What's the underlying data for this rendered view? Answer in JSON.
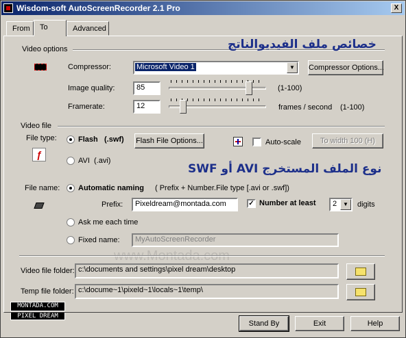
{
  "window": {
    "title": "Wisdom-soft AutoScreenRecorder 2.1 Pro",
    "close_label": "X"
  },
  "tabs": [
    {
      "label": "From"
    },
    {
      "label": "To"
    },
    {
      "label": "Advanced"
    }
  ],
  "video_options": {
    "section_label": "Video options",
    "arabic_caption": "خصائص ملف الفيديوالناتج",
    "compressor_label": "Compressor:",
    "compressor_value": "Microsoft Video 1",
    "compressor_options_button": "Compressor Options...",
    "image_quality_label": "Image quality:",
    "image_quality_value": "85",
    "image_quality_range": "(1-100)",
    "image_quality_level": 0.85,
    "framerate_label": "Framerate:",
    "framerate_value": "12",
    "framerate_unit": "frames / second",
    "framerate_range": "(1-100)",
    "framerate_level": 0.12
  },
  "video_file": {
    "section_label": "Video file",
    "file_type_label": "File type:",
    "flash_label": "Flash",
    "flash_ext": "(.swf)",
    "flash_options_button": "Flash File Options...",
    "auto_scale_label": "Auto-scale",
    "to_width_button": "To width 100 (H)",
    "avi_label": "AVI",
    "avi_ext": "(.avi)",
    "arabic_caption": "نوع الملف المستخرج AVI أو SWF"
  },
  "file_name": {
    "label": "File name:",
    "automatic_label": "Automatic naming",
    "automatic_hint": "( Prefix + Number.File type [.avi or .swf])",
    "prefix_label": "Prefix:",
    "prefix_value": "Pixeldream@montada.com",
    "number_label": "Number at least",
    "number_value": "2",
    "digits_label": "digits",
    "ask_label": "Ask me each time",
    "fixed_label": "Fixed name:",
    "fixed_value": "MyAutoScreenRecorder"
  },
  "folders": {
    "video_label": "Video file folder:",
    "video_path": "c:\\documents and settings\\pixel dream\\desktop",
    "temp_label": "Temp file folder:",
    "temp_path": "c:\\docume~1\\pixeld~1\\locals~1\\temp\\"
  },
  "logo": {
    "line1": "MONTADA.COM",
    "line2": "PIXEL DREAM"
  },
  "watermark": {
    "url": "www.Montada.com"
  },
  "footer": {
    "standby": "Stand By",
    "exit": "Exit",
    "help": "Help"
  },
  "colors": {
    "title_start": "#0a246a",
    "title_end": "#a6caf0",
    "caption": "#1c2f8a"
  }
}
